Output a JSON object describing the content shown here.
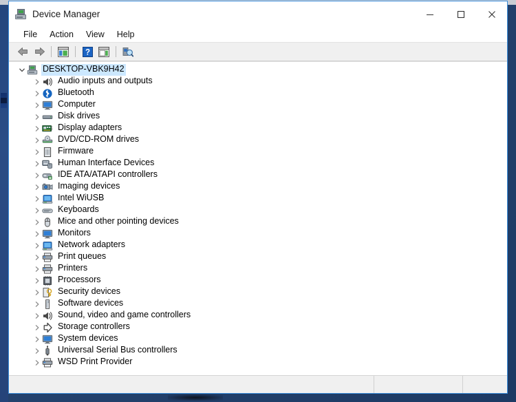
{
  "window": {
    "title": "Device Manager",
    "title_icon": "device-manager-icon",
    "controls": {
      "minimize": "─",
      "maximize": "□",
      "close": "✕"
    }
  },
  "menubar": {
    "items": [
      {
        "label": "File",
        "name": "menu-file"
      },
      {
        "label": "Action",
        "name": "menu-action"
      },
      {
        "label": "View",
        "name": "menu-view"
      },
      {
        "label": "Help",
        "name": "menu-help"
      }
    ]
  },
  "toolbar": {
    "buttons": [
      {
        "name": "back-button",
        "icon": "left-arrow-icon"
      },
      {
        "name": "forward-button",
        "icon": "right-arrow-icon"
      },
      {
        "name": "show-hide-console-tree-button",
        "icon": "console-tree-icon"
      },
      {
        "name": "help-button",
        "icon": "question-mark-icon"
      },
      {
        "name": "properties-button",
        "icon": "properties-window-icon"
      },
      {
        "name": "scan-hardware-changes-button",
        "icon": "scan-hardware-icon"
      }
    ]
  },
  "tree": {
    "root": {
      "label": "DESKTOP-VBK9H42",
      "icon": "computer-node-icon",
      "expanded": true,
      "selected": true
    },
    "children": [
      {
        "label": "Audio inputs and outputs",
        "icon": "speaker-icon"
      },
      {
        "label": "Bluetooth",
        "icon": "bluetooth-icon"
      },
      {
        "label": "Computer",
        "icon": "monitor-icon"
      },
      {
        "label": "Disk drives",
        "icon": "disk-drive-icon"
      },
      {
        "label": "Display adapters",
        "icon": "display-adapter-icon"
      },
      {
        "label": "DVD/CD-ROM drives",
        "icon": "optical-drive-icon"
      },
      {
        "label": "Firmware",
        "icon": "firmware-chip-icon"
      },
      {
        "label": "Human Interface Devices",
        "icon": "hid-icon"
      },
      {
        "label": "IDE ATA/ATAPI controllers",
        "icon": "ide-controller-icon"
      },
      {
        "label": "Imaging devices",
        "icon": "camera-icon"
      },
      {
        "label": "Intel WiUSB",
        "icon": "network-card-icon"
      },
      {
        "label": "Keyboards",
        "icon": "keyboard-icon"
      },
      {
        "label": "Mice and other pointing devices",
        "icon": "mouse-icon"
      },
      {
        "label": "Monitors",
        "icon": "monitor-icon"
      },
      {
        "label": "Network adapters",
        "icon": "network-card-icon"
      },
      {
        "label": "Print queues",
        "icon": "printer-icon"
      },
      {
        "label": "Printers",
        "icon": "printer-icon"
      },
      {
        "label": "Processors",
        "icon": "processor-icon"
      },
      {
        "label": "Security devices",
        "icon": "security-key-icon"
      },
      {
        "label": "Software devices",
        "icon": "software-device-icon"
      },
      {
        "label": "Sound, video and game controllers",
        "icon": "speaker-icon"
      },
      {
        "label": "Storage controllers",
        "icon": "storage-controller-icon"
      },
      {
        "label": "System devices",
        "icon": "monitor-icon"
      },
      {
        "label": "Universal Serial Bus controllers",
        "icon": "usb-icon"
      },
      {
        "label": "WSD Print Provider",
        "icon": "printer-icon"
      }
    ]
  },
  "statusbar": {
    "main_text": "",
    "segment_2_text": "",
    "segment_3_text": ""
  },
  "colors": {
    "selection": "#cce8ff",
    "window_border": "#3a8ddb",
    "toolbar_bg": "#f0f0f0",
    "statusbar_bg": "#f0f0f0",
    "desktop": "#24426e"
  }
}
